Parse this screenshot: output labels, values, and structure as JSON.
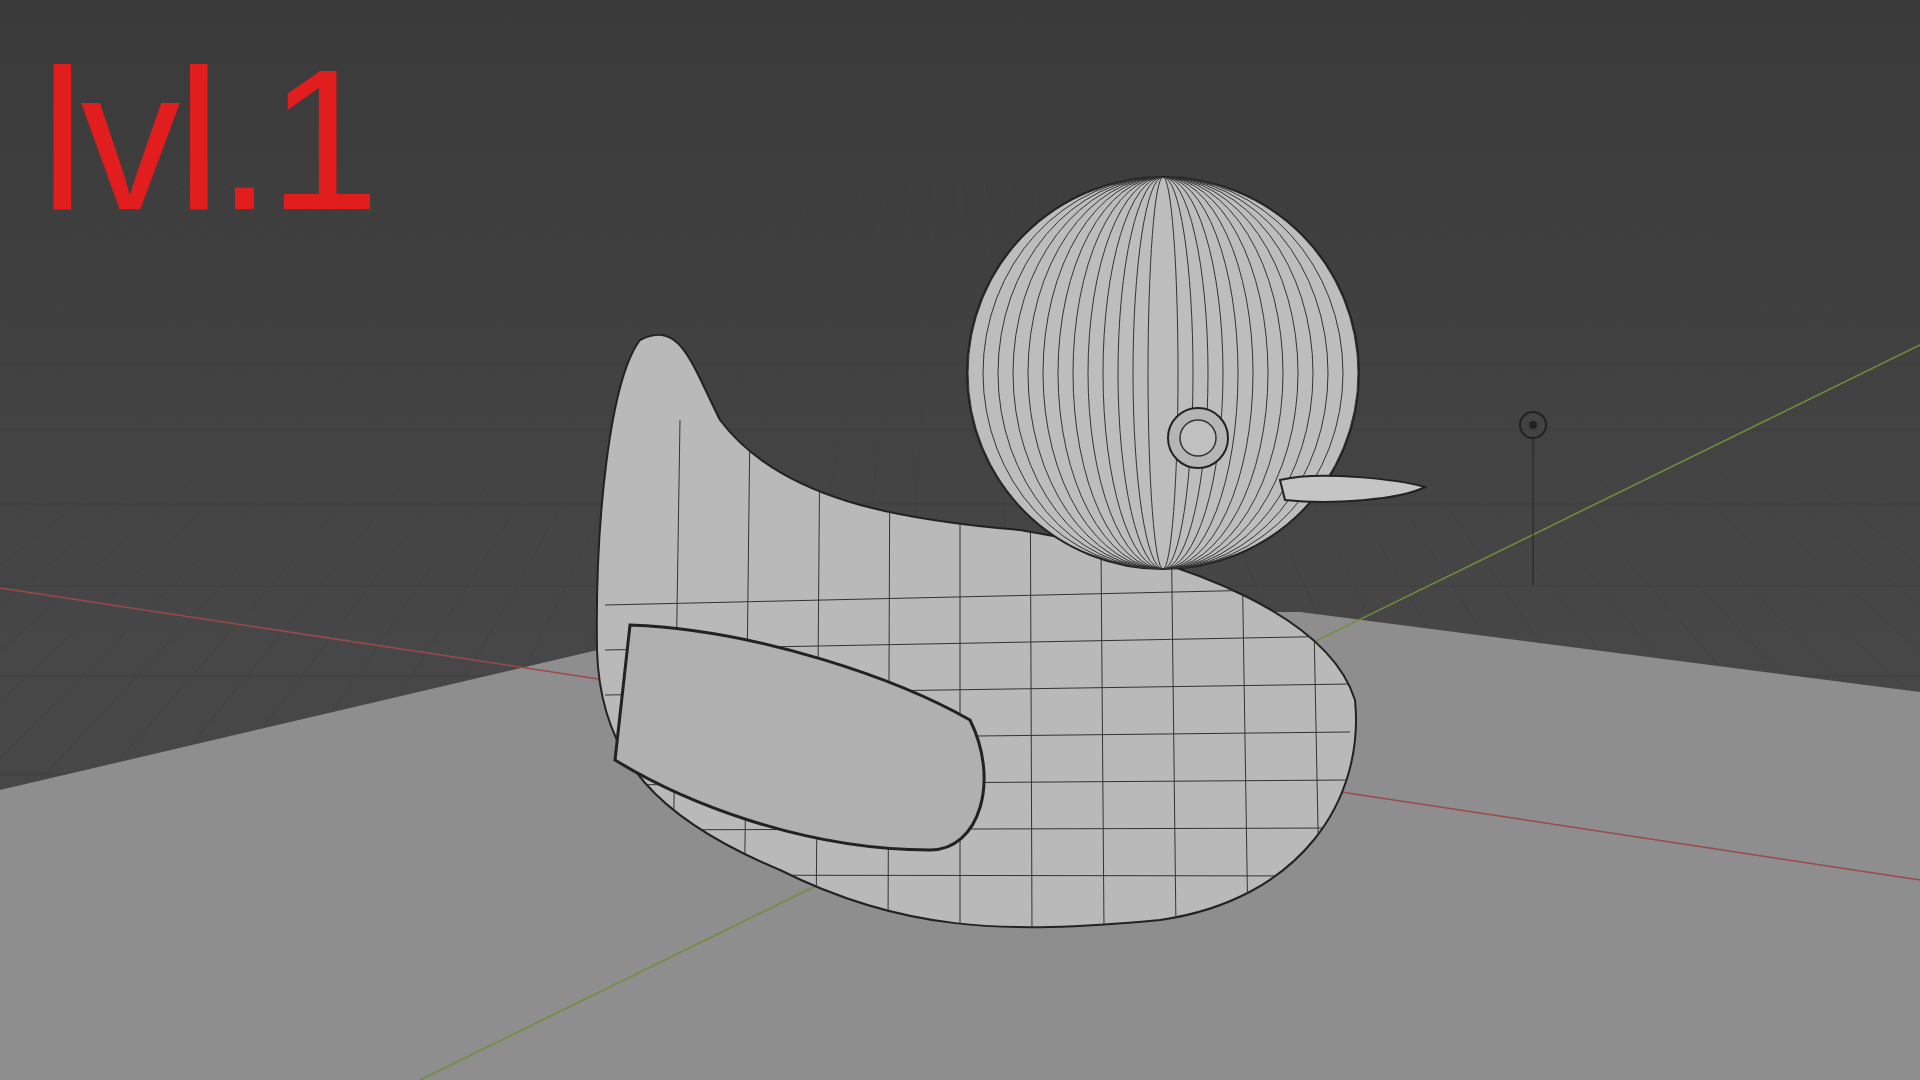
{
  "viewport": {
    "overlay_text": "lvl.1"
  }
}
